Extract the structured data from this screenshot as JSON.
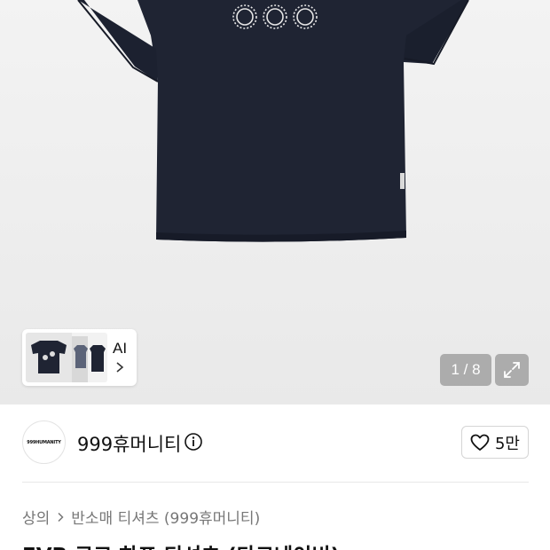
{
  "gallery": {
    "ai_label": "AI",
    "counter": "1 / 8"
  },
  "seller": {
    "logo_text": "999HUMANITY",
    "name": "999휴머니티",
    "like_count": "5만"
  },
  "breadcrumb": {
    "items": [
      "상의",
      "반소매 티셔츠 (999휴머니티)"
    ]
  },
  "product": {
    "title": "EVB 로고 하프 티셔츠 (다크네이비)"
  },
  "colors": {
    "shirt": "#1f2433",
    "background": "#ededed"
  }
}
